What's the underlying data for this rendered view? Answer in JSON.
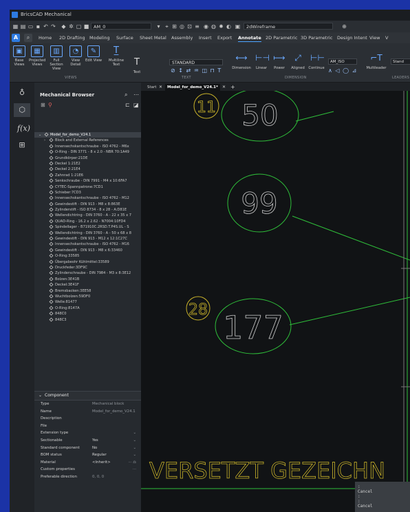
{
  "app": {
    "title": "BricsCAD Mechanical"
  },
  "qat": {
    "layer": "AM_0",
    "visual_style": "2dWireframe"
  },
  "menu": {
    "tabs": [
      "Home",
      "2D Drafting",
      "Modeling",
      "Surface",
      "Sheet Metal",
      "Assembly",
      "Insert",
      "Export",
      "Annotate",
      "2D Parametric",
      "3D Parametric",
      "Design Intent",
      "View",
      "V"
    ],
    "active": "Annotate"
  },
  "ribbon": {
    "views_buttons": [
      "Base Views",
      "Projected Views",
      "Full Section View",
      "View Detail",
      "Edit View",
      "Multiline Text",
      "Text"
    ],
    "text_style": "STANDARD",
    "dim_buttons": [
      "Dimension",
      "Linear",
      "Power",
      "Aligned",
      "Continue"
    ],
    "dim_style": "AM_ISO",
    "leader_buttons": [
      "Multileader",
      "Stand"
    ],
    "groups": [
      "VIEWS",
      "TEXT",
      "DIMENSION",
      "LEADERS"
    ]
  },
  "browser": {
    "title": "Mechanical Browser",
    "root": "Model_for_demo_V24.1",
    "items": [
      "Block and External References",
      "Innensechskantschraube - ISO 4762 - M6x",
      "O-Ring - DIN 3771 - 8 x 2.0 - NBR 70:1A49",
      "Grundkörper:21DE",
      "Deckel 1:21E2",
      "Deckel 2:21E4",
      "Zahnrad 1:21E6",
      "Senkschraube - DIN 7991 - M4 x 10:6FA7",
      "CYTEC-Spannpatrone:7CD1",
      "Schieber:7CD3",
      "Innensechskantschraube - ISO 4762 - M12",
      "Gewindestift - DIN 913 - M8 x 8:863E",
      "Zylinderstift - ISO 8734 - 8 x 28 - A:D81E",
      "Wellendichtring - DIN 3760 - A - 22 x 35 x 7",
      "QUAD-Ring - 16.2 x 2.62 - N7004:10FD4",
      "Spindellager - B71910C.2RSD.T.P4S.UL - S",
      "Wellendichtring - DIN 3760 - A - 50 x 68 x 8",
      "Gewindestift - DIN 913 - M12 x 12:1C27C",
      "Innensechskantschraube - ISO 4762 - M16",
      "Gewindestift - DIN 913 - M8 x 6:33460",
      "O-Ring:33585",
      "Übergabeohr Kühlmittel:33589",
      "Druckfeder:3DF9C",
      "Zylinderschraube - DIN 7984 - M3 x 8:3E12",
      "Bolzen:3E41B",
      "Deckel:3E41F",
      "Bremsbacken:3EE58",
      "Wuchtbolzen:59DF0",
      "Welle:81477",
      "O-Ring:8147A",
      "848C0",
      "848C3"
    ]
  },
  "properties": {
    "section": "Component",
    "rows": [
      {
        "key": "Type",
        "value": "Mechanical block",
        "dim": true
      },
      {
        "key": "Name",
        "value": "Model_for_demo_V24.1",
        "dim": true
      },
      {
        "key": "Description",
        "value": "",
        "dim": false
      },
      {
        "key": "File",
        "value": "",
        "dim": false
      },
      {
        "key": "Extension type",
        "value": "",
        "dim": false,
        "dd": true
      },
      {
        "key": "Sectionable",
        "value": "Yes",
        "dim": false,
        "dd": true
      },
      {
        "key": "Standard component",
        "value": "No",
        "dim": false,
        "dd": true
      },
      {
        "key": "BOM status",
        "value": "Regular",
        "dim": false,
        "dd": true
      },
      {
        "key": "Material",
        "value": "<Inherit>",
        "dim": false,
        "extra": "··· ⚖"
      },
      {
        "key": "Custom properties",
        "value": "",
        "dim": false,
        "extra": "···"
      },
      {
        "key": "Preferable direction",
        "value": "0, 0, 0",
        "dim": true
      }
    ]
  },
  "doc_tabs": [
    "Start",
    "Model_for_demo_V24.1*"
  ],
  "drawing": {
    "balloons": [
      "50",
      "99",
      "177"
    ],
    "tags": [
      "11",
      "28"
    ],
    "note": "VERSETZT GEZEICHN",
    "line_color": "#2fbf3a",
    "tag_color": "#c8b22a"
  },
  "cmdline": {
    "lines": [
      ":",
      "Cancel",
      ":",
      ":",
      "Cancel"
    ]
  }
}
